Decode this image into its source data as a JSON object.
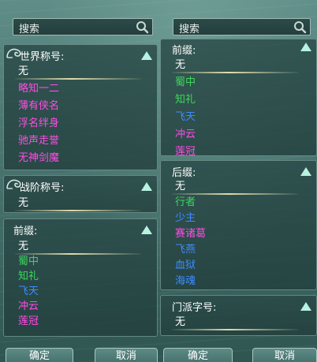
{
  "left": {
    "search": {
      "placeholder": "搜索",
      "icon": "search-icon"
    },
    "title_panel": {
      "title": "世界称号:",
      "items": [
        {
          "label": "无",
          "color": "#ffffff",
          "selected": true
        },
        {
          "label": "略知一二",
          "color": "#ff4ce6"
        },
        {
          "label": "薄有侠名",
          "color": "#ff4ce6"
        },
        {
          "label": "浮名绊身",
          "color": "#ff4ce6"
        },
        {
          "label": "驰声走誉",
          "color": "#ff4ce6"
        },
        {
          "label": "无神剑魔",
          "color": "#ff4ce6"
        }
      ]
    },
    "rank_panel": {
      "title": "战阶称号:",
      "items": [
        {
          "label": "无",
          "color": "#ffffff",
          "selected": true
        }
      ]
    },
    "prefix_panel": {
      "title": "前缀:",
      "items": [
        {
          "label": "无",
          "color": "#ffffff",
          "selected": true
        },
        {
          "label": "蜀中",
          "color": "#3cd85a"
        },
        {
          "label": "知礼",
          "color": "#3cd85a"
        },
        {
          "label": "飞天",
          "color": "#3e8cff"
        },
        {
          "label": "冲云",
          "color": "#ff4ce6"
        },
        {
          "label": "莲冠",
          "color": "#ff4ce6"
        }
      ]
    },
    "confirm_label": "确定",
    "cancel_label": "取消"
  },
  "right": {
    "search": {
      "placeholder": "搜索",
      "icon": "search-icon"
    },
    "prefix_panel": {
      "title": "前缀:",
      "items": [
        {
          "label": "无",
          "color": "#ffffff",
          "selected": true
        },
        {
          "label": "蜀中",
          "color": "#3cd85a"
        },
        {
          "label": "知礼",
          "color": "#3cd85a"
        },
        {
          "label": "飞天",
          "color": "#3e8cff"
        },
        {
          "label": "冲云",
          "color": "#ff4ce6"
        },
        {
          "label": "莲冠",
          "color": "#ff4ce6"
        }
      ]
    },
    "suffix_panel": {
      "title": "后缀:",
      "items": [
        {
          "label": "无",
          "color": "#ffffff",
          "selected": true
        },
        {
          "label": "行者",
          "color": "#3cd85a"
        },
        {
          "label": "少主",
          "color": "#3e8cff"
        },
        {
          "label": "赛诸葛",
          "color": "#ff4ce6"
        },
        {
          "label": "飞燕",
          "color": "#3e8cff"
        },
        {
          "label": "血狱",
          "color": "#3e8cff"
        },
        {
          "label": "海魂",
          "color": "#3e8cff"
        }
      ]
    },
    "sect_panel": {
      "title": "门派字号:",
      "items": [
        {
          "label": "无",
          "color": "#ffffff",
          "selected": true
        }
      ]
    },
    "confirm_label": "确定",
    "cancel_label": "取消"
  },
  "colors": {
    "accent_triangle": "#b8f2e2",
    "selection_underline": "#fff5be"
  }
}
